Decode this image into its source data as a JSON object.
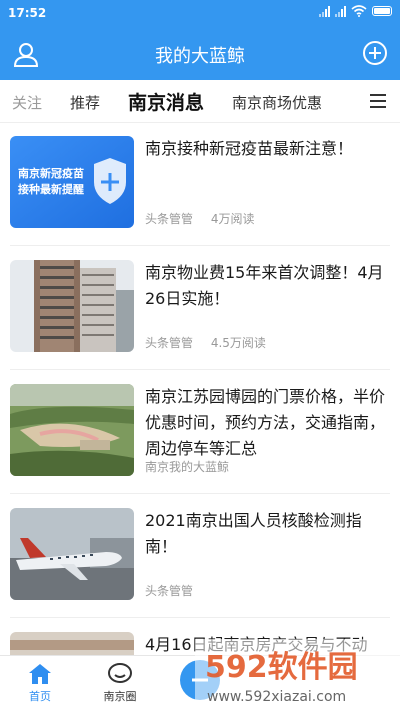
{
  "status_bar": {
    "time": "17:52"
  },
  "header": {
    "title": "我的大蓝鲸"
  },
  "tabs": {
    "items": [
      {
        "label": "关注"
      },
      {
        "label": "推荐"
      },
      {
        "label": "南京消息"
      },
      {
        "label": "南京商场优惠"
      }
    ]
  },
  "feed": {
    "items": [
      {
        "title": "南京接种新冠疫苗最新注意！",
        "thumb_text_line1": "南京新冠疫苗",
        "thumb_text_line2": "接种最新提醒",
        "source": "头条管管",
        "reads": "4万阅读"
      },
      {
        "title": "南京物业费15年来首次调整！4月26日实施！",
        "source": "头条管管",
        "reads": "4.5万阅读"
      },
      {
        "title": "南京江苏园博园的门票价格，半价优惠时间，预约方法，交通指南，周边停车等汇总",
        "source": "南京我的大蓝鲸",
        "reads": ""
      },
      {
        "title": "2021南京出国人员核酸检测指南！",
        "source": "头条管管",
        "reads": ""
      },
      {
        "title": "4月16日起南京房产交易与不动",
        "source": "",
        "reads": ""
      }
    ]
  },
  "bottom_nav": {
    "items": [
      {
        "label": "首页"
      },
      {
        "label": "南京圈"
      }
    ]
  },
  "watermark": {
    "brand": "592软件园",
    "url": "www.592xiazai.com"
  },
  "colors": {
    "primary": "#3497f0",
    "tab_active": "#111111",
    "meta": "#999999"
  }
}
